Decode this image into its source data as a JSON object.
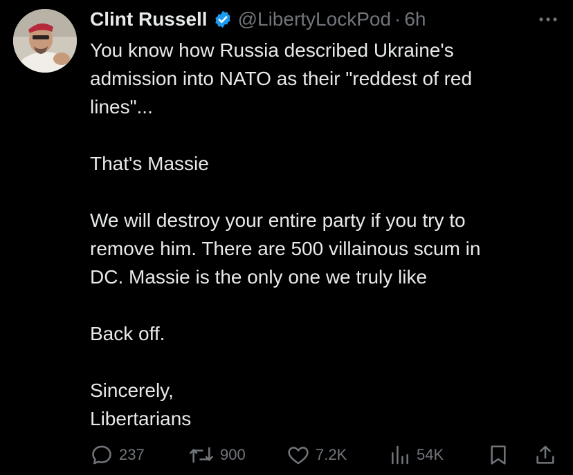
{
  "author": {
    "display_name": "Clint Russell",
    "handle": "@LibertyLockPod",
    "separator": "·",
    "timestamp": "6h",
    "verified": true
  },
  "tweet": {
    "paragraphs": [
      [
        "You know how Russia described Ukraine's",
        "admission into NATO as their \"reddest of red",
        "lines\"..."
      ],
      [
        "That's Massie"
      ],
      [
        "We will destroy your entire party if you try to",
        "remove him. There are 500 villainous scum in",
        "DC. Massie is the only one we truly like"
      ],
      [
        "Back off."
      ],
      [
        "Sincerely,",
        "Libertarians"
      ]
    ]
  },
  "actions": {
    "replies": "237",
    "reposts": "900",
    "likes": "7.2K",
    "views": "54K"
  },
  "icons": {
    "verified": "verified-badge-icon",
    "more": "more-icon",
    "reply": "reply-icon",
    "repost": "repost-icon",
    "like": "heart-icon",
    "views": "views-icon",
    "bookmark": "bookmark-icon",
    "share": "share-icon"
  },
  "colors": {
    "background": "#000000",
    "text_primary": "#e7e9ea",
    "text_secondary": "#71767b",
    "verified_blue": "#1d9bf0"
  }
}
